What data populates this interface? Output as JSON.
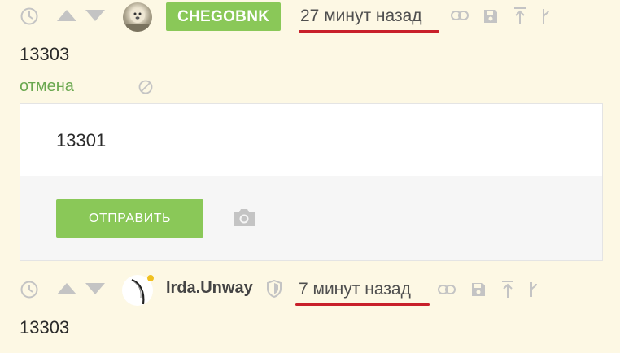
{
  "comment1": {
    "username": "CHEGOBNK",
    "time": "27 минут назад",
    "text": "13303"
  },
  "reply_form": {
    "cancel_label": "отмена",
    "input_value": "13301",
    "submit_label": "ОТПРАВИТЬ"
  },
  "comment2": {
    "username": "Irda.Unway",
    "time": "7 минут назад",
    "text": "13303"
  },
  "colors": {
    "background": "#fdf8e4",
    "accent_green": "#8ac858",
    "underline_red": "#c8202a",
    "icon_gray": "#c4c4c4"
  },
  "icons": [
    "clock-icon",
    "upvote-icon",
    "downvote-icon",
    "link-icon",
    "save-icon",
    "scroll-up-icon",
    "branch-icon",
    "cancel-icon",
    "camera-icon",
    "shield-icon"
  ]
}
